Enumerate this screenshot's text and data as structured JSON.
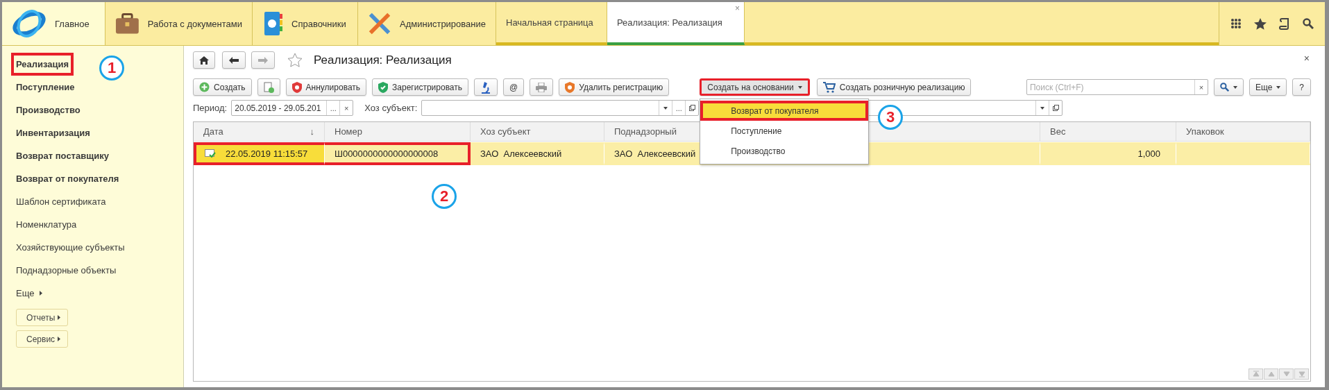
{
  "top_bar": {
    "sections": [
      {
        "label": "Главное",
        "kind": "logo",
        "selected": true
      },
      {
        "label": "Работа с документами",
        "kind": "briefcase",
        "selected": false
      },
      {
        "label": "Справочники",
        "kind": "book",
        "selected": false
      },
      {
        "label": "Администрирование",
        "kind": "tools",
        "selected": false
      }
    ],
    "tabs": [
      {
        "label": "Начальная страница",
        "selected": false
      },
      {
        "label": "Реализация: Реализация",
        "selected": true,
        "close": "×"
      }
    ]
  },
  "sidebar": {
    "items": [
      {
        "label": "Реализация",
        "bold": true,
        "highlighted": true
      },
      {
        "label": "Поступление",
        "bold": true,
        "highlighted": false
      },
      {
        "label": "Производство",
        "bold": true,
        "highlighted": false
      },
      {
        "label": "Инвентаризация",
        "bold": true,
        "highlighted": false
      },
      {
        "label": "Возврат поставщику",
        "bold": true,
        "highlighted": false
      },
      {
        "label": "Возврат от покупателя",
        "bold": true,
        "highlighted": false
      },
      {
        "label": "Шаблон сертификата",
        "bold": false,
        "highlighted": false
      },
      {
        "label": "Номенклатура",
        "bold": false,
        "highlighted": false
      },
      {
        "label": "Хозяйствующие субъекты",
        "bold": false,
        "highlighted": false
      },
      {
        "label": "Поднадзорные объекты",
        "bold": false,
        "highlighted": false
      }
    ],
    "more": "Еще",
    "buttons": [
      "Отчеты",
      "Сервис"
    ]
  },
  "form": {
    "title": "Реализация: Реализация",
    "close": "×",
    "toolbar": [
      {
        "kind": "create",
        "label": "Создать"
      },
      {
        "kind": "copy"
      },
      {
        "kind": "cancel",
        "label": "Аннулировать"
      },
      {
        "kind": "register",
        "label": "Зарегистрировать"
      },
      {
        "kind": "microscope"
      },
      {
        "kind": "at",
        "label": "@"
      },
      {
        "kind": "print"
      },
      {
        "kind": "unregister",
        "label": "Удалить регистрацию"
      },
      {
        "kind": "menu",
        "label": "Создать на основании",
        "expanded": true,
        "highlighted": true
      },
      {
        "kind": "cart",
        "label": "Создать розничную реализацию"
      }
    ],
    "search": {
      "placeholder": "Поиск (Ctrl+F)",
      "clear": "×"
    },
    "more": "Еще",
    "help": "?",
    "menu_items": [
      {
        "label": "Возврат от покупателя",
        "selected": true,
        "highlighted": true
      },
      {
        "label": "Поступление",
        "selected": false,
        "highlighted": false
      },
      {
        "label": "Производство",
        "selected": false,
        "highlighted": false
      }
    ],
    "filters": {
      "period_label": "Период:",
      "period_value": "20.05.2019 - 29.05.201",
      "period_pick": "...",
      "period_clear": "×",
      "subject_label": "Хоз субъект:",
      "subject_pick": "..."
    },
    "table": {
      "columns": [
        {
          "label": "Дата",
          "sort": "↓"
        },
        {
          "label": "Номер"
        },
        {
          "label": "Хоз субъект"
        },
        {
          "label": "Поднадзорный"
        },
        {
          "covered": true
        },
        {
          "label": "Вес"
        },
        {
          "label": "Упаковок"
        }
      ],
      "rows": [
        {
          "selected": true,
          "posted": true,
          "highlighted": true,
          "cells": [
            "22.05.2019 11:15:57",
            "Ш0000000000000000008",
            "ЗАО  Алексеевский",
            "ЗАО  Алексеевский",
            null,
            "1,000",
            null
          ]
        }
      ]
    }
  },
  "annotations": [
    {
      "label": "1"
    },
    {
      "label": "2"
    },
    {
      "label": "3"
    }
  ]
}
